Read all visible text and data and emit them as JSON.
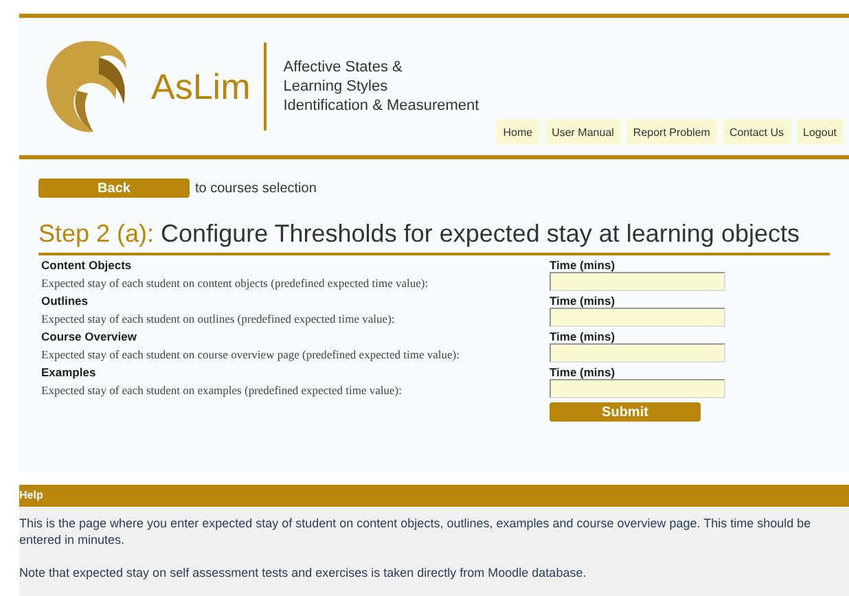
{
  "header": {
    "logo_text": "AsLim",
    "tagline": [
      "Affective States &",
      "Learning Styles",
      "Identification & Measurement"
    ],
    "nav": [
      "Home",
      "User Manual",
      "Report Problem",
      "Contact Us",
      "Logout"
    ]
  },
  "back": {
    "button": "Back",
    "text": "to courses selection"
  },
  "title": {
    "step": "Step 2 (a):",
    "text": "Configure Thresholds for expected stay at learning objects"
  },
  "rows": [
    {
      "label": "Content Objects",
      "description": "Expected stay of each student on content objects (predefined expected time value):",
      "field_label": "Time (mins)"
    },
    {
      "label": "Outlines",
      "description": "Expected stay of each student on outlines (predefined expected time value):",
      "field_label": "Time (mins)"
    },
    {
      "label": "Course Overview",
      "description": "Expected stay of each student on course overview page (predefined expected time value):",
      "field_label": "Time (mins)"
    },
    {
      "label": "Examples",
      "description": "Expected stay of each student on examples (predefined expected time value):",
      "field_label": "Time (mins)"
    }
  ],
  "submit": "Submit",
  "help": {
    "title": "Help",
    "paragraphs": [
      "This is the page where you enter expected stay of student on content objects, outlines, examples and course overview page. This time should be entered in minutes.",
      "Note that expected stay on self assessment tests and exercises is taken directly from Moodle database."
    ]
  }
}
